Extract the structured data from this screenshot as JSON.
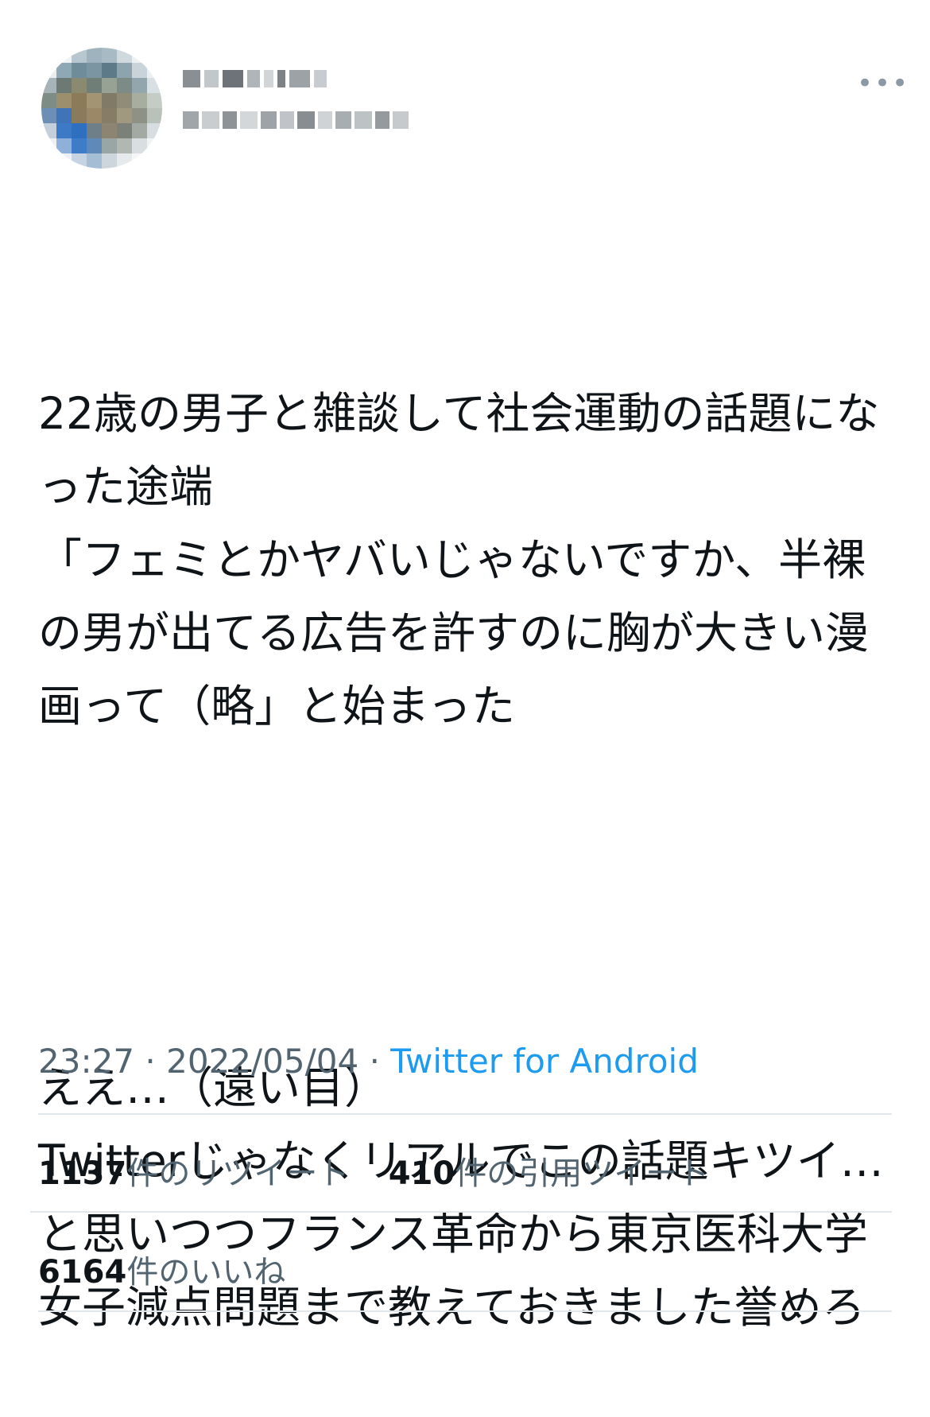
{
  "user": {
    "avatar_icon": "profile-avatar-blurred",
    "display_name": "",
    "handle": ""
  },
  "more_icon": "more-horizontal-icon",
  "tweet": {
    "paragraphs": [
      "22歳の男子と雑談して社会運動の話題になった途端\n「フェミとかヤバいじゃないですか、半裸の男が出てる広告を許すのに胸が大きい漫画って（略」と始まった",
      "ええ…（遠い目）\nTwitterじゃなくリアルでこの話題キツイ…と思いつつフランス革命から東京医科大学女子減点問題まで教えておきました誉めろ"
    ]
  },
  "meta": {
    "time": "23:27",
    "separator": "·",
    "date": "2022/05/04",
    "source": "Twitter for Android"
  },
  "stats": {
    "retweets_count": "1137",
    "retweets_label": "件のリツイート",
    "quotes_count": "410",
    "quotes_label": "件の引用ツイート",
    "likes_count": "6164",
    "likes_label": "件のいいね"
  },
  "colors": {
    "text": "#0f1419",
    "secondary": "#536471",
    "link": "#1d9bf0",
    "divider": "#e1e6ea"
  }
}
